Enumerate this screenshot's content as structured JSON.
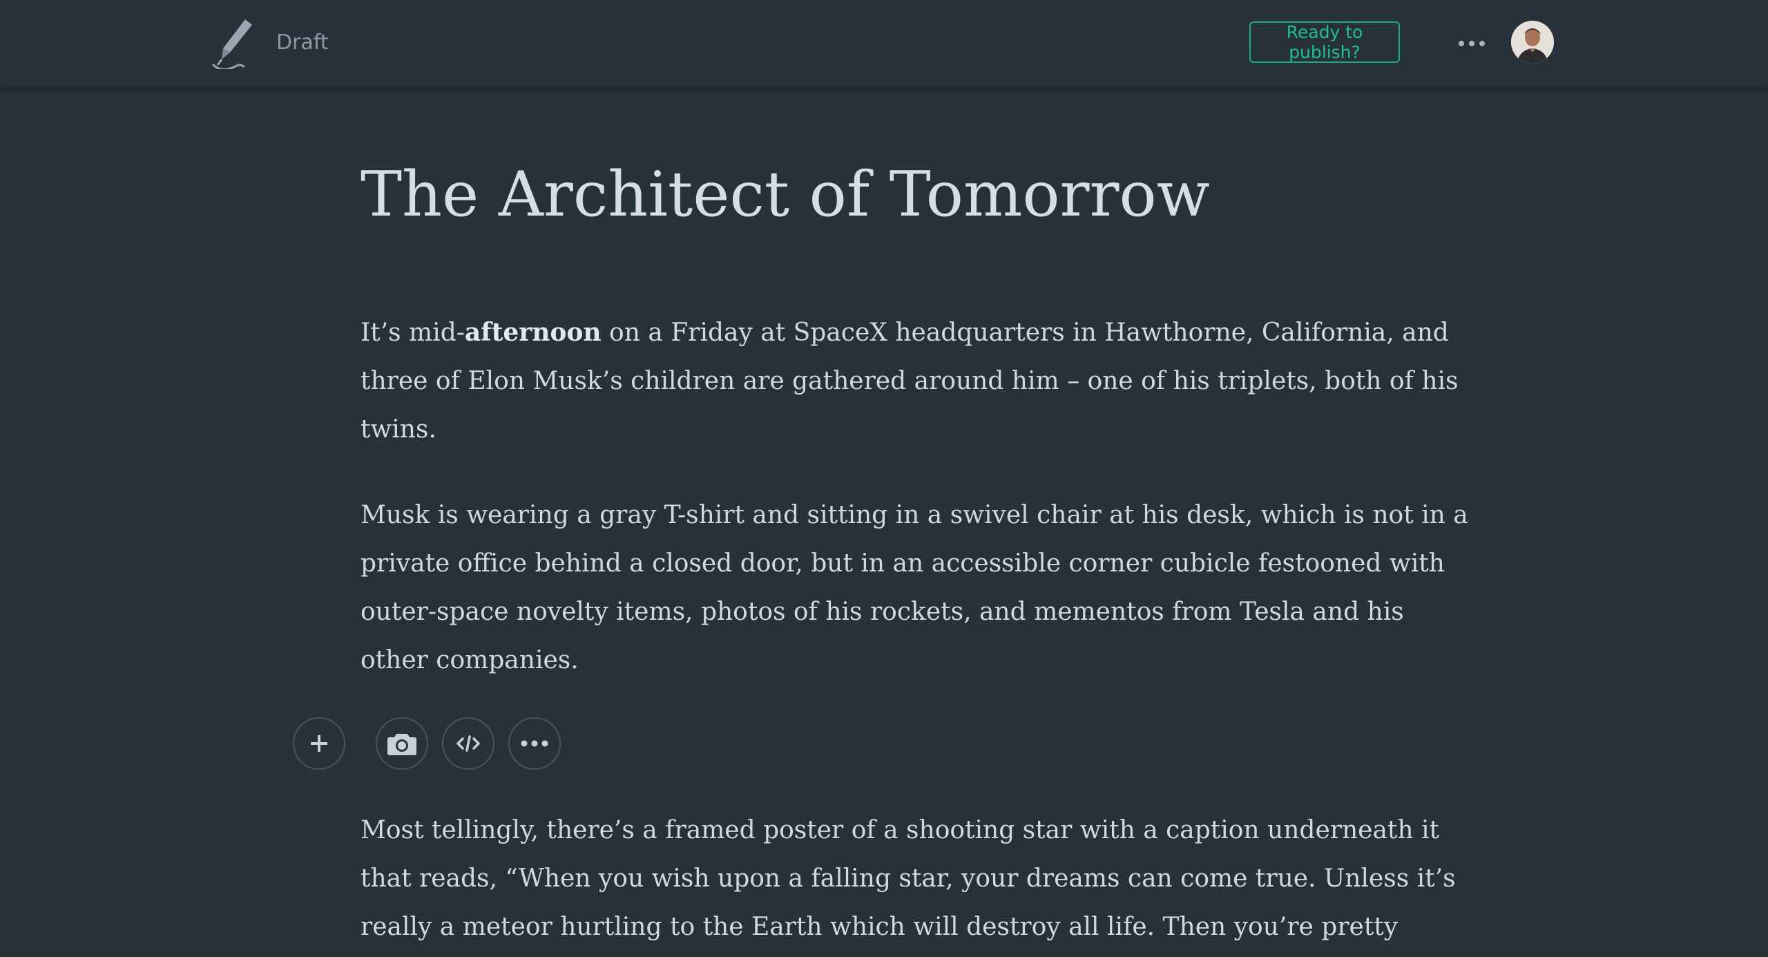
{
  "header": {
    "logo_icon": "quill-pen-icon",
    "status_label": "Draft",
    "publish_button_label": "Ready to publish?",
    "more_icon": "ellipsis-icon",
    "avatar_icon": "user-avatar",
    "accent_color": "#1fae7f"
  },
  "article": {
    "title": "The Architect of Tomorrow",
    "paragraph1": {
      "line1_prefix": "It’s mid-",
      "line1_bold": "afternoon",
      "line1_suffix": " on a Friday at SpaceX headquarters in Hawthorne, California, and",
      "line2": "three of Elon Musk’s children are gathered around him – one of his triplets, both of his",
      "line3": "twins."
    },
    "paragraph2": {
      "line1": "Musk is wearing a gray T-shirt and sitting in a swivel chair at his desk, which is not in a",
      "line2": "private office behind a closed door, but in an accessible corner cubicle festooned with",
      "line3": "outer-space novelty items, photos of his rockets, and mementos from Tesla and his",
      "line4": "other companies."
    },
    "paragraph3": {
      "line1": "Most tellingly, there’s a framed poster of a shooting star with a caption underneath it",
      "line2": "that reads, “When you wish upon a falling star, your dreams can come true. Unless it’s",
      "line3": "really a meteor hurtling to the Earth which will destroy all life. Then you’re pretty"
    }
  },
  "insert_toolbar": {
    "icons": [
      "plus-icon",
      "camera-icon",
      "embed-code-icon",
      "ellipsis-icon"
    ]
  },
  "colors": {
    "background": "#27313a",
    "text": "#d2d8de",
    "muted": "#8d98a3"
  }
}
